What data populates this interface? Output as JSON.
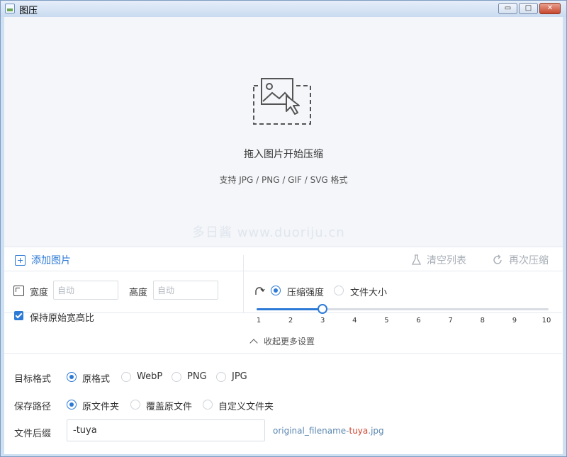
{
  "window": {
    "title": "图压",
    "minimize": "▭",
    "maximize": "□",
    "close": "✕"
  },
  "dropzone": {
    "title": "拖入图片开始压缩",
    "subtitle": "支持 JPG / PNG / GIF / SVG 格式",
    "watermark": "多日酱  www.duoriju.cn",
    "icon": "image-drop-icon"
  },
  "toolbar": {
    "add_label": "添加图片",
    "clear_label": "清空列表",
    "recompress_label": "再次压缩"
  },
  "size": {
    "width_label": "宽度",
    "width_placeholder": "自动",
    "height_label": "高度",
    "height_placeholder": "自动",
    "keep_ratio_label": "保持原始宽高比",
    "keep_ratio_checked": true
  },
  "compress": {
    "mode_strength_label": "压缩强度",
    "mode_size_label": "文件大小",
    "selected_mode": "压缩强度",
    "slider_ticks": [
      "1",
      "2",
      "3",
      "4",
      "5",
      "6",
      "7",
      "8",
      "9",
      "10"
    ],
    "slider_value": 3,
    "slider_min": 1,
    "slider_max": 10
  },
  "collapse_label": "收起更多设置",
  "format": {
    "label": "目标格式",
    "options": [
      "原格式",
      "WebP",
      "PNG",
      "JPG"
    ],
    "selected": "原格式"
  },
  "save_path": {
    "label": "保存路径",
    "options": [
      "原文件夹",
      "覆盖原文件",
      "自定义文件夹"
    ],
    "selected": "原文件夹"
  },
  "suffix": {
    "label": "文件后缀",
    "value": "-tuya",
    "hint_prefix": "original_filename-",
    "hint_suffix": "tuya",
    "hint_ext": ".jpg"
  },
  "colors": {
    "accent": "#2d7ad6",
    "muted": "#a7adb5",
    "highlight": "#d0472f"
  }
}
